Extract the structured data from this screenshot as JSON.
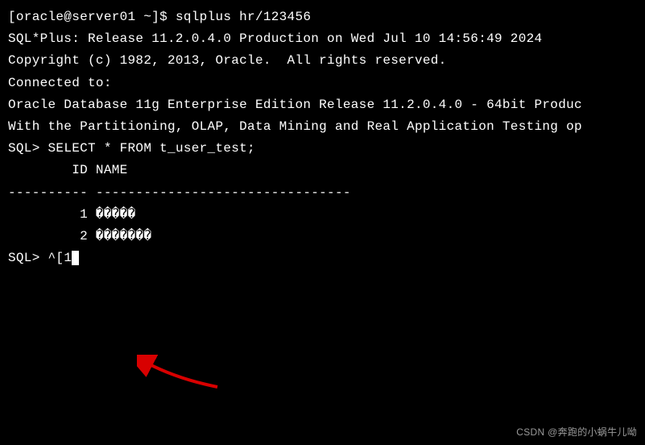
{
  "terminal": {
    "prompt_shell": "[oracle@server01 ~]$ ",
    "cmd_sqlplus": "sqlplus hr/123456",
    "blank": "",
    "banner1": "SQL*Plus: Release 11.2.0.4.0 Production on Wed Jul 10 14:56:49 2024",
    "copyright": "Copyright (c) 1982, 2013, Oracle.  All rights reserved.",
    "connected_label": "Connected to:",
    "connected1": "Oracle Database 11g Enterprise Edition Release 11.2.0.4.0 - 64bit Produc",
    "connected2": "With the Partitioning, OLAP, Data Mining and Real Application Testing op",
    "sql_prompt1": "SQL> ",
    "query": "SELECT * FROM t_user_test;",
    "header": "        ID NAME",
    "divider": "---------- --------------------------------",
    "row1": "         1 �����",
    "row2": "         2 �������",
    "sql_prompt2": "SQL> ",
    "escape_seq": "^[1"
  },
  "watermark": "CSDN @奔跑的小蜗牛儿呦"
}
